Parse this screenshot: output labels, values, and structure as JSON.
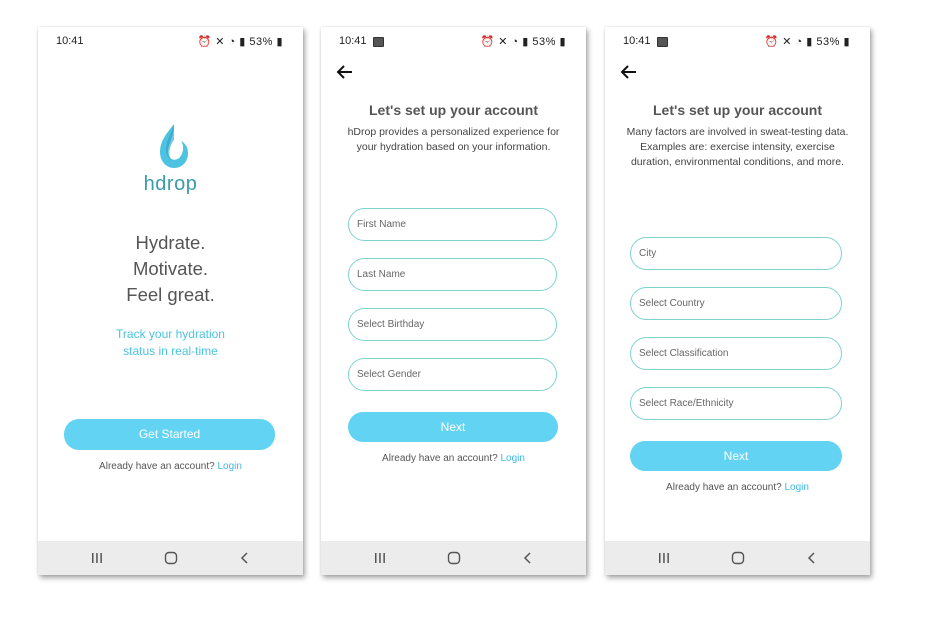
{
  "screens": [
    {
      "status": {
        "time": "10:41",
        "battery": "53%"
      },
      "logo_text": "hdrop",
      "tagline": [
        "Hydrate.",
        "Motivate.",
        "Feel great."
      ],
      "subtitle": [
        "Track your hydration",
        "status in real-time"
      ],
      "primary_button": "Get Started",
      "account_prompt": "Already have an account?",
      "login_link": "Login"
    },
    {
      "status": {
        "time": "10:41",
        "battery": "53%"
      },
      "title": "Let's set up your account",
      "description": "hDrop provides a personalized experience for your hydration based on your information.",
      "fields": [
        {
          "placeholder": "First Name"
        },
        {
          "placeholder": "Last Name"
        },
        {
          "placeholder": "Select Birthday"
        },
        {
          "placeholder": "Select Gender"
        }
      ],
      "primary_button": "Next",
      "account_prompt": "Already have an account?",
      "login_link": "Login"
    },
    {
      "status": {
        "time": "10:41",
        "battery": "53%"
      },
      "title": "Let's set up your account",
      "description": "Many factors are involved in sweat-testing data. Examples are: exercise intensity, exercise duration, environmental conditions, and more.",
      "fields": [
        {
          "placeholder": "City"
        },
        {
          "placeholder": "Select Country"
        },
        {
          "placeholder": "Select Classification"
        },
        {
          "placeholder": "Select Race/Ethnicity"
        }
      ],
      "primary_button": "Next",
      "account_prompt": "Already have an account?",
      "login_link": "Login"
    }
  ],
  "colors": {
    "accent": "#63d3f3",
    "field_border": "#7fd3cf",
    "link": "#3fb9e6",
    "brand_text": "#3a9aad",
    "nav_bar": "#ececec"
  },
  "icons": [
    "back-arrow-icon",
    "recent-apps-icon",
    "home-icon",
    "nav-back-icon",
    "water-drop-logo-icon",
    "gallery-icon",
    "alarm-icon",
    "mute-icon",
    "wifi-icon",
    "signal-icon",
    "battery-icon"
  ]
}
